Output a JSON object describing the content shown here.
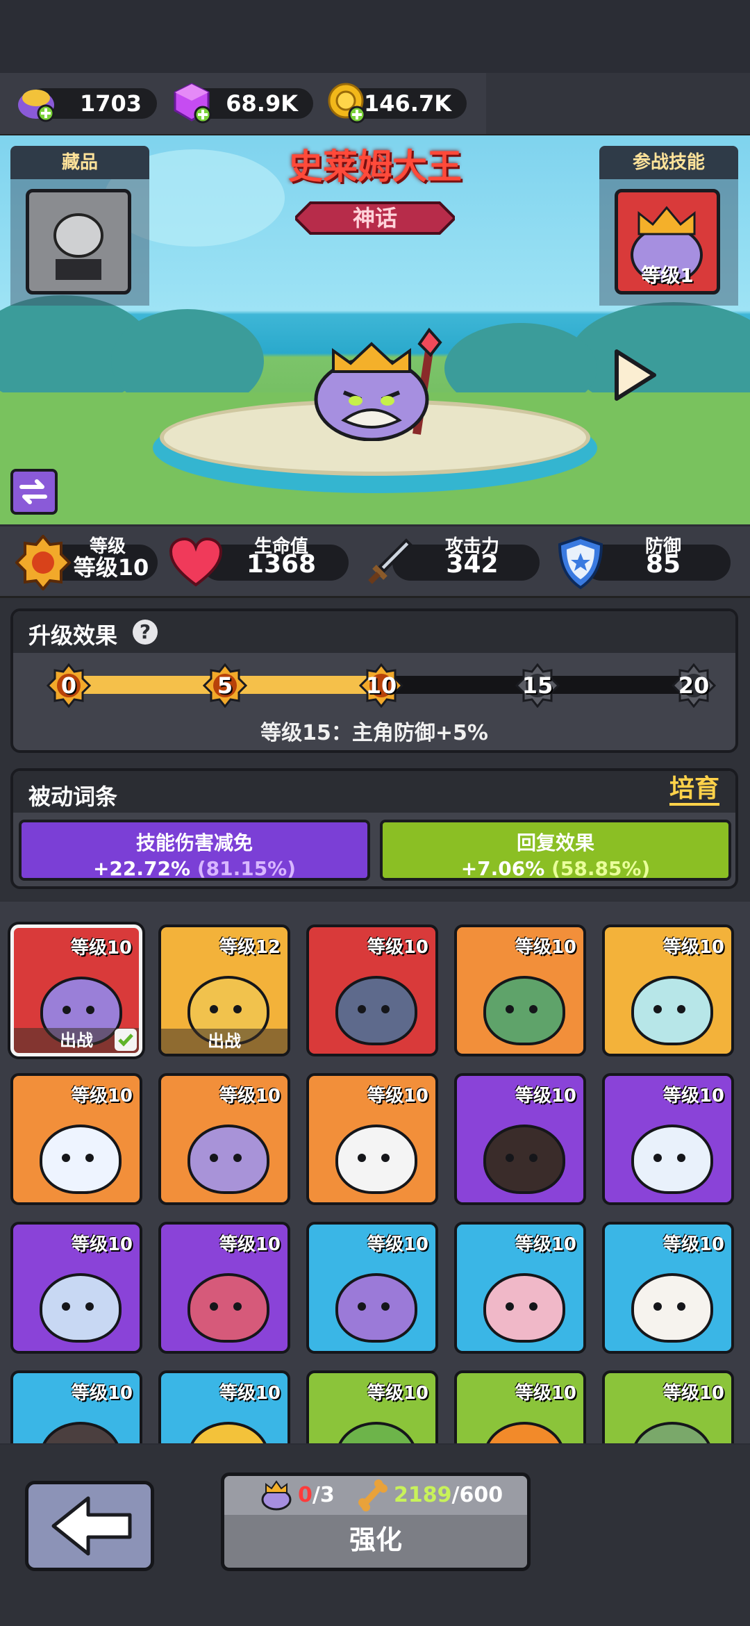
{
  "currency": [
    {
      "icon": "pudding-icon",
      "value": "1703"
    },
    {
      "icon": "purple-gem-icon",
      "value": "68.9K"
    },
    {
      "icon": "gold-coin-icon",
      "value": "146.7K"
    }
  ],
  "hero": {
    "name": "史莱姆大王",
    "rarity": "神话",
    "collection_title": "藏品",
    "skill_title": "参战技能",
    "skill_level": "等级1"
  },
  "stats": [
    {
      "icon": "level-badge-icon",
      "label": "等级",
      "value": "等级10"
    },
    {
      "icon": "heart-icon",
      "label": "生命值",
      "value": "1368"
    },
    {
      "icon": "sword-icon",
      "label": "攻击力",
      "value": "342"
    },
    {
      "icon": "shield-icon",
      "label": "防御",
      "value": "85"
    }
  ],
  "upgrade": {
    "title": "升级效果",
    "milestones": [
      "0",
      "5",
      "10",
      "15",
      "20"
    ],
    "current_level": 10,
    "max_level": 20,
    "next_effect": "等级15：主角防御+5%"
  },
  "passive": {
    "title": "被动词条",
    "train_label": "培育",
    "items": [
      {
        "name": "技能伤害减免",
        "value": "+22.72%",
        "cap": "(81.15%)",
        "color": "#7b3fd6"
      },
      {
        "name": "回复效果",
        "value": "+7.06%",
        "cap": "(58.85%)",
        "color": "#8bbf24"
      }
    ]
  },
  "pets": [
    {
      "level": "等级10",
      "bg": "#d93a3a",
      "blob": "#9a7fd8",
      "status": "出战",
      "selected": true
    },
    {
      "level": "等级12",
      "bg": "#f3b23a",
      "blob": "#f1c24d",
      "status": "出战",
      "selected": false
    },
    {
      "level": "等级10",
      "bg": "#d93a3a",
      "blob": "#5e6a8c",
      "status": "",
      "selected": false
    },
    {
      "level": "等级10",
      "bg": "#f28f3a",
      "blob": "#5fa36a",
      "status": "",
      "selected": false
    },
    {
      "level": "等级10",
      "bg": "#f3b23a",
      "blob": "#b7e6e8",
      "status": "",
      "selected": false
    },
    {
      "level": "等级10",
      "bg": "#f28f3a",
      "blob": "#eef4ff",
      "status": "",
      "selected": false
    },
    {
      "level": "等级10",
      "bg": "#f28f3a",
      "blob": "#a893d8",
      "status": "",
      "selected": false
    },
    {
      "level": "等级10",
      "bg": "#f28f3a",
      "blob": "#f4f4f4",
      "status": "",
      "selected": false
    },
    {
      "level": "等级10",
      "bg": "#8a43d8",
      "blob": "#3a2c2a",
      "status": "",
      "selected": false
    },
    {
      "level": "等级10",
      "bg": "#8a43d8",
      "blob": "#e9f1fb",
      "status": "",
      "selected": false
    },
    {
      "level": "等级10",
      "bg": "#8a43d8",
      "blob": "#c8d8f3",
      "status": "",
      "selected": false
    },
    {
      "level": "等级10",
      "bg": "#8a43d8",
      "blob": "#d65a7a",
      "status": "",
      "selected": false
    },
    {
      "level": "等级10",
      "bg": "#3ab6e6",
      "blob": "#9b7ad8",
      "status": "",
      "selected": false
    },
    {
      "level": "等级10",
      "bg": "#3ab6e6",
      "blob": "#f0b8c8",
      "status": "",
      "selected": false
    },
    {
      "level": "等级10",
      "bg": "#3ab6e6",
      "blob": "#f6f3ee",
      "status": "",
      "selected": false
    },
    {
      "level": "等级10",
      "bg": "#3ab6e6",
      "blob": "#4b3f3f",
      "status": "",
      "selected": false
    },
    {
      "level": "等级10",
      "bg": "#3ab6e6",
      "blob": "#f3c23a",
      "status": "",
      "selected": false
    },
    {
      "level": "等级10",
      "bg": "#8bc43a",
      "blob": "#6db44a",
      "status": "",
      "selected": false
    },
    {
      "level": "等级10",
      "bg": "#8bc43a",
      "blob": "#f28a2a",
      "status": "",
      "selected": false
    },
    {
      "level": "等级10",
      "bg": "#8bc43a",
      "blob": "#7aa86a",
      "status": "",
      "selected": false
    }
  ],
  "bottom": {
    "fragments_have": "0",
    "fragments_need": "/3",
    "bones_have": "2189",
    "bones_need": "/600",
    "upgrade_label": "强化"
  },
  "colors": {
    "title_red": "#ff4a3a",
    "progress_gold": "#f5c04a",
    "train_gold": "#ffd24a",
    "fragment_red": "#ff3b3b",
    "bone_green": "#c8f25a"
  }
}
